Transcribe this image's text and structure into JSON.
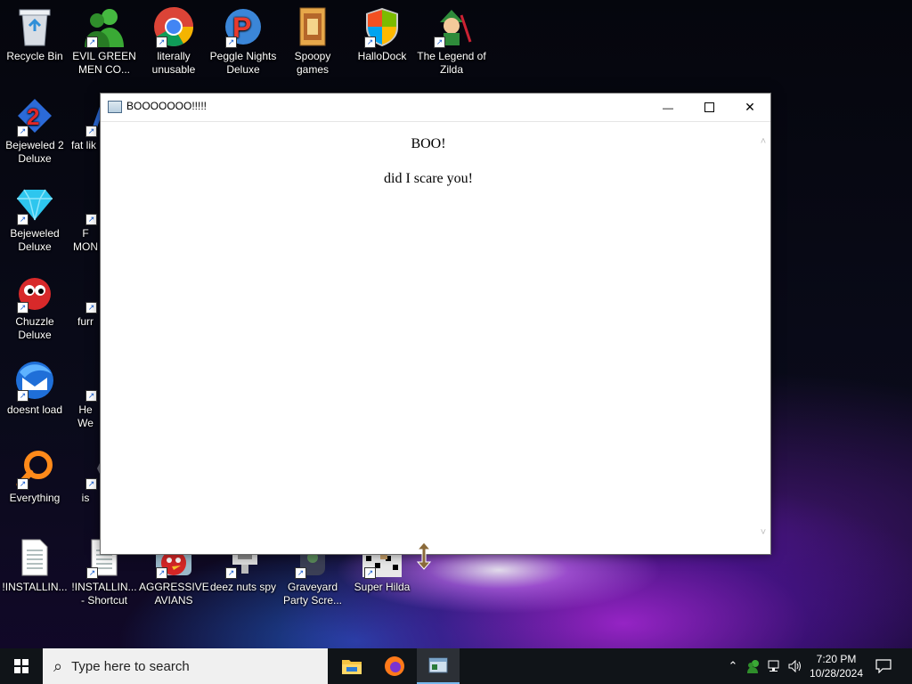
{
  "desktop": {
    "icons": [
      {
        "label": "Recycle Bin",
        "icon": "recycle-bin-icon"
      },
      {
        "label": "EVIL GREEN MEN CO...",
        "icon": "green-men-icon"
      },
      {
        "label": "literally unusable",
        "icon": "chrome-icon"
      },
      {
        "label": "Peggle Nights Deluxe",
        "icon": "peggle-icon"
      },
      {
        "label": "Spoopy games",
        "icon": "folder-icon"
      },
      {
        "label": "HalloDock",
        "icon": "windows-shield-icon"
      },
      {
        "label": "The Legend of Zilda",
        "icon": "zilda-icon"
      },
      {
        "label": "Bejeweled 2 Deluxe",
        "icon": "bejeweled2-icon"
      },
      {
        "label": "fat lik",
        "icon": "app-icon"
      },
      {
        "label": "Bejeweled Deluxe",
        "icon": "diamond-icon"
      },
      {
        "label": "F MON",
        "icon": "app-icon"
      },
      {
        "label": "Chuzzle Deluxe",
        "icon": "chuzzle-icon"
      },
      {
        "label": "furr",
        "icon": "firefox-icon"
      },
      {
        "label": "doesnt load",
        "icon": "thunderbird-icon"
      },
      {
        "label": "He We",
        "icon": "app-icon"
      },
      {
        "label": "Everything",
        "icon": "everything-search-icon"
      },
      {
        "label": "is",
        "icon": "app-icon"
      },
      {
        "label": "!INSTALLIN...",
        "icon": "text-file-icon"
      },
      {
        "label": "!INSTALLIN... - Shortcut",
        "icon": "text-file-icon"
      },
      {
        "label": "AGGRESSIVE AVIANS",
        "icon": "angry-bird-icon"
      },
      {
        "label": "deez nuts spy",
        "icon": "spy-icon"
      },
      {
        "label": "Graveyard Party Scre...",
        "icon": "graveyard-icon"
      },
      {
        "label": "Super Hilda",
        "icon": "pixel-game-icon"
      }
    ]
  },
  "window": {
    "title": "BOOOOOOO!!!!!",
    "minimize": "—",
    "maximize": "☐",
    "close": "✕",
    "heading": "BOO!",
    "message": "did I scare you!"
  },
  "taskbar": {
    "search_placeholder": "Type here to search",
    "time": "7:20 PM",
    "date": "10/28/2024"
  }
}
